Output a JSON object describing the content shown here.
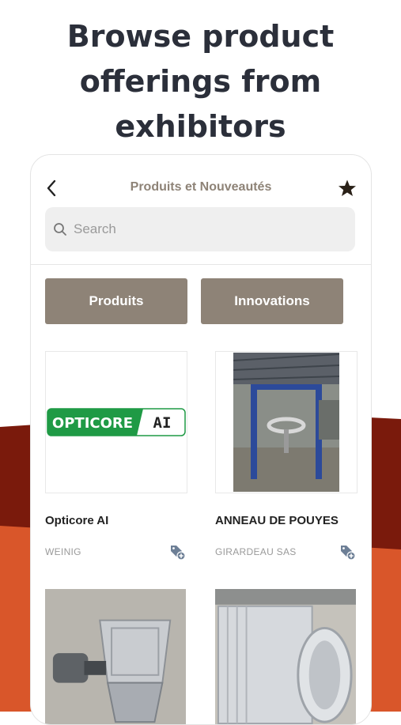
{
  "headline": "Browse product offerings from exhibitors",
  "app": {
    "title": "Produits et Nouveautés",
    "back_icon": "chevron-left-icon",
    "favorite_icon": "star-icon"
  },
  "search": {
    "placeholder": "Search",
    "value": ""
  },
  "tabs": [
    {
      "label": "Produits"
    },
    {
      "label": "Innovations"
    }
  ],
  "products": [
    {
      "name": "Opticore AI",
      "company": "WEINIG",
      "logo_text_1": "OPTICORE",
      "logo_text_2": "AI"
    },
    {
      "name": "ANNEAU DE POUYES",
      "company": "GIRARDEAU SAS"
    },
    {
      "name": "",
      "company": ""
    },
    {
      "name": "",
      "company": ""
    }
  ],
  "colors": {
    "brand_taupe": "#8e8377",
    "dark_red": "#7a1a0c",
    "orange": "#d9562a",
    "opticore_green": "#1f9a45",
    "add_icon_blue": "#6d7f96"
  }
}
